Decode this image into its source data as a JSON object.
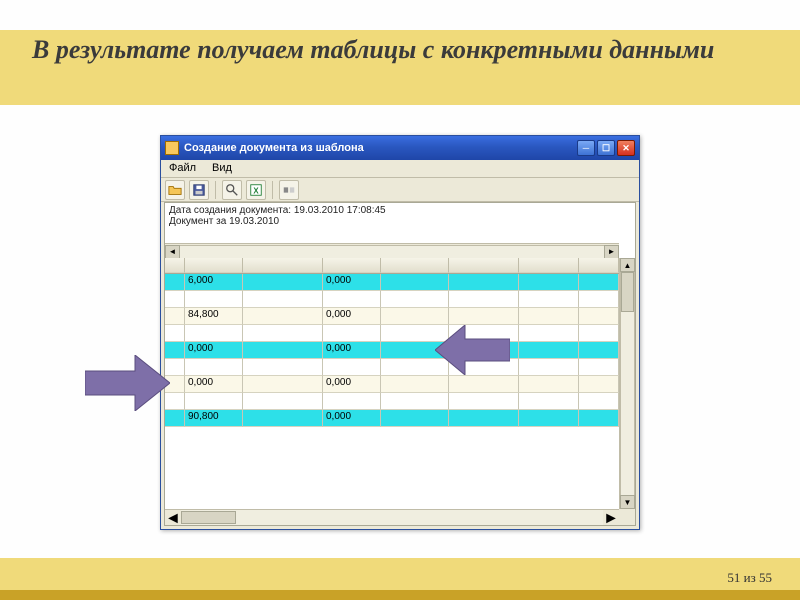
{
  "slide": {
    "title": "В результате получаем таблицы с конкретными данными",
    "pager": "51 из 55"
  },
  "window": {
    "title": "Создание документа из шаблона",
    "menu": {
      "file": "Файл",
      "view": "Вид"
    },
    "info_line1": "Дата создания документа: 19.03.2010 17:08:45",
    "info_line2": "Документ за 19.03.2010"
  },
  "table": {
    "rows": [
      {
        "style": "cyan",
        "c1": "6,000",
        "c3": "0,000"
      },
      {
        "style": "white",
        "c1": "",
        "c3": ""
      },
      {
        "style": "cream",
        "c1": "84,800",
        "c3": "0,000"
      },
      {
        "style": "white",
        "c1": "",
        "c3": ""
      },
      {
        "style": "cyan",
        "c1": "0,000",
        "c3": "0,000"
      },
      {
        "style": "white",
        "c1": "",
        "c3": ""
      },
      {
        "style": "cream",
        "c1": "0,000",
        "c3": "0,000"
      },
      {
        "style": "white",
        "c1": "",
        "c3": ""
      },
      {
        "style": "cyan",
        "c1": "90,800",
        "c3": "0,000"
      }
    ]
  },
  "icons": {
    "open": "open-folder-icon",
    "save": "floppy-icon",
    "zoom": "magnifier-icon",
    "excel": "excel-icon",
    "tool": "toggle-icon"
  }
}
